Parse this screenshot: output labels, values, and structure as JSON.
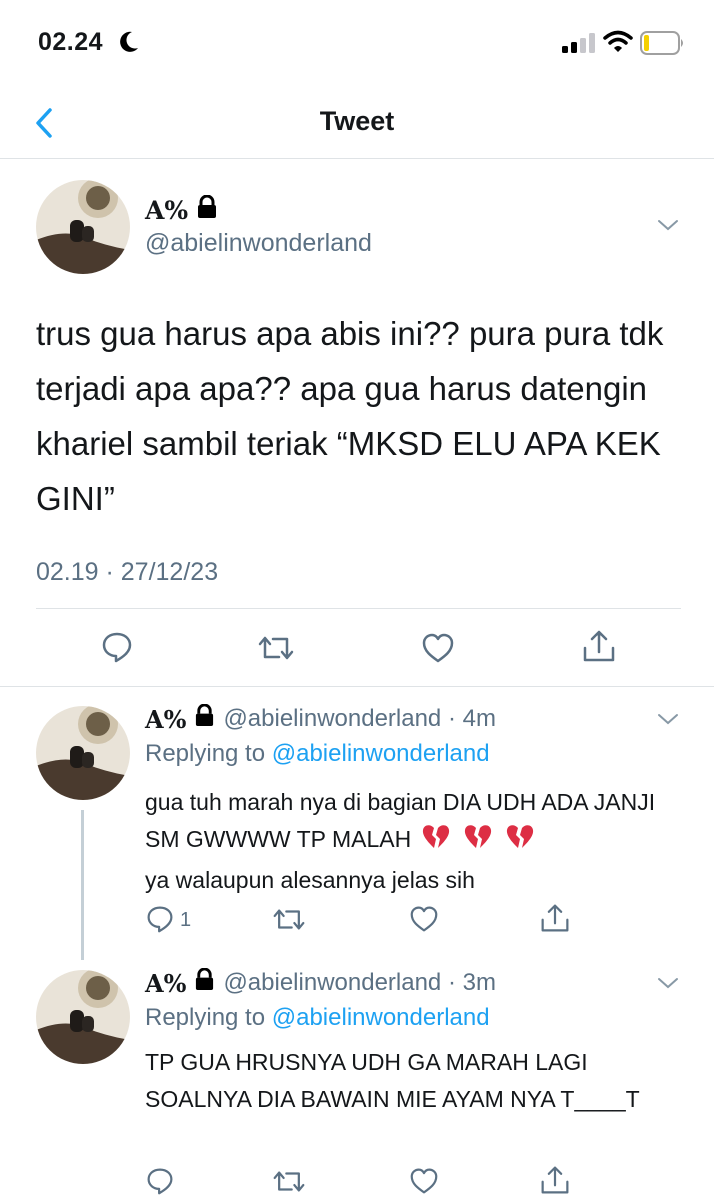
{
  "status": {
    "time": "02.24"
  },
  "nav": {
    "title": "Tweet"
  },
  "main_tweet": {
    "name": "A%",
    "handle": "@abielinwonderland",
    "text": "trus gua harus apa abis ini?? pura pura tdk terjadi apa apa?? apa gua harus datengin khariel sambil teriak “MKSD ELU APA KEK GINI”",
    "timestamp": "02.19 · 27/12/23"
  },
  "replies": [
    {
      "name": "A%",
      "meta": "@abielinwonderland · 4m",
      "replying_prefix": "Replying to",
      "replying_handle": "@abielinwonderland",
      "text_part1": "gua tuh marah nya di bagian DIA UDH ADA JANJI SM GWWWW TP MALAH",
      "text_part2": "ya walaupun alesannya jelas sih",
      "reply_count": "1"
    },
    {
      "name": "A%",
      "meta": "@abielinwonderland · 3m",
      "replying_prefix": "Replying to",
      "replying_handle": "@abielinwonderland",
      "text": "TP GUA HRUSNYA UDH GA MARAH LAGI SOALNYA DIA BAWAIN MIE AYAM NYA T____T"
    }
  ],
  "icons": [
    "moon-icon",
    "signal-icon",
    "wifi-icon",
    "battery-icon",
    "back-chevron-icon",
    "lock-icon",
    "chevron-down-icon",
    "reply-icon",
    "retweet-icon",
    "like-icon",
    "share-icon",
    "broken-heart-emoji"
  ],
  "colors": {
    "accent": "#1da1f2",
    "secondary_text": "#5b7083",
    "divider": "#dfe3e6"
  }
}
